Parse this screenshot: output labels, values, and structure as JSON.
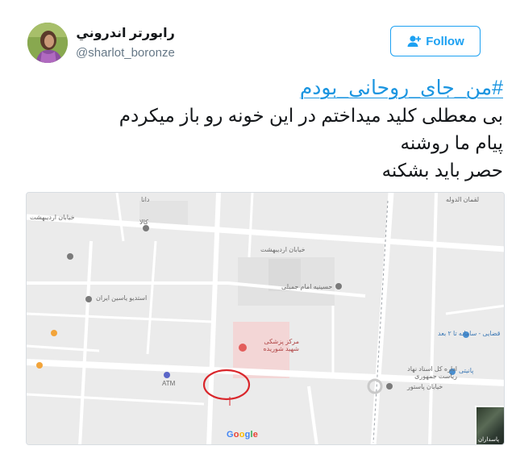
{
  "author": {
    "display_name": "رابورتر اندروني",
    "handle": "@sharlot_boronze"
  },
  "follow_button": {
    "label": "Follow",
    "accent": "#1da1f2"
  },
  "tweet": {
    "hashtag": "#من_جای_روحانی_بودم",
    "lines": [
      "بی معطلی کلید میداختم در این خونه رو باز میکردم",
      "پیام ما روشنه",
      "حصر باید بشکنه"
    ]
  },
  "map": {
    "labels": {
      "top_left": "خیابان اردیبهشت",
      "top_mid": "دانا",
      "kala": "کالا",
      "top_right": "لقمان الدوله",
      "mid_left": "خیابان اردیبهشت",
      "husseinieh": "حسینیه امام جمیلی",
      "studio": "استدیو یاسین ایران",
      "hospital": "مرکز پزشکی شهید شوریده",
      "office": "اداره کل اسناد نهاد ریاست جمهوری",
      "street_bottom": "خیابان پاستور",
      "atm": "ATM",
      "fresh": "قضایی - سامانه تا ۲ بعد",
      "shop": "پانیتی",
      "thumb": "پاسداران"
    },
    "google_letters": [
      "G",
      "o",
      "o",
      "g",
      "l",
      "e"
    ],
    "google_colors": [
      "#4285f4",
      "#ea4335",
      "#fbbc05",
      "#4285f4",
      "#34a853",
      "#ea4335"
    ],
    "circle_color": "#d9262b"
  }
}
